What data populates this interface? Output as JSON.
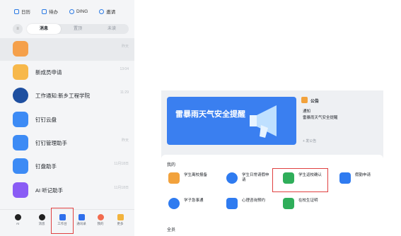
{
  "topbar": {
    "items": [
      {
        "label": "日历",
        "icon": "calendar-icon"
      },
      {
        "label": "待办",
        "icon": "todo-icon"
      },
      {
        "label": "DING",
        "icon": "ding-icon"
      },
      {
        "label": "邀请",
        "icon": "invite-icon"
      }
    ]
  },
  "filter": {
    "tabs": [
      "消息",
      "置顶",
      "未读"
    ],
    "active": 0
  },
  "chats": [
    {
      "name": "",
      "time": "昨天",
      "color": "#f5a04a"
    },
    {
      "name": "新成员申请",
      "time": "13:04",
      "color": "#f7b84b"
    },
    {
      "name": "工作通知:新乡工程学院",
      "time": "11:29",
      "color": "#1e4fa0"
    },
    {
      "name": "钉钉云盘",
      "time": "",
      "color": "#3d8bf5"
    },
    {
      "name": "钉钉管理助手",
      "time": "昨天",
      "color": "#3d8bf5"
    },
    {
      "name": "钉盘助手",
      "time": "11月18日",
      "color": "#3d8bf5"
    },
    {
      "name": "AI 听记助手",
      "time": "11月18日",
      "color": "#8a5cf5"
    }
  ],
  "bottom_nav": [
    {
      "label": "AI",
      "color": "#222222"
    },
    {
      "label": "消息",
      "color": "#222222"
    },
    {
      "label": "工作台",
      "color": "#2f6fec"
    },
    {
      "label": "通讯录",
      "color": "#2f6fec"
    },
    {
      "label": "我的",
      "color": "#f26b4e"
    },
    {
      "label": "更多",
      "color": "#f2b33d"
    }
  ],
  "banner": {
    "text": "雷暴雨天气安全提醒"
  },
  "notice": {
    "badge": "公告",
    "line1": "通知",
    "line2": "雷暴雨天气安全提醒",
    "more": "+ 发公告"
  },
  "apps_section": {
    "title": "我的",
    "footer": "全员"
  },
  "apps": [
    {
      "label": "学生离校报备",
      "color": "#f2a23c"
    },
    {
      "label": "学生日常请假申请",
      "color": "#2f7bf0"
    },
    {
      "label": "学生返校确认",
      "color": "#2fae5a"
    },
    {
      "label": "假勤申请",
      "color": "#2f7bf0"
    },
    {
      "label": "学子急事通",
      "color": "#2f7bf0"
    },
    {
      "label": "心理咨询预约",
      "color": "#2f7bf0"
    },
    {
      "label": "在校生证明",
      "color": "#2fae5a"
    }
  ]
}
